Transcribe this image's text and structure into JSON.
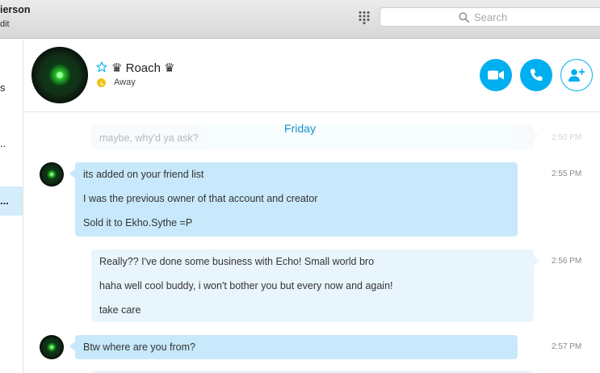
{
  "account": {
    "name": "ierson",
    "edit_label": "dit"
  },
  "search": {
    "placeholder": "Search"
  },
  "sidebar": {
    "fragments": [
      "s",
      "..",
      "..."
    ]
  },
  "contact": {
    "prefix_crown": "♛",
    "name": "Roach",
    "suffix_crown": "♛",
    "status": "Away"
  },
  "colors": {
    "accent": "#00aff0",
    "incoming_bubble": "#c8e9fb",
    "outgoing_bubble": "#e9f5fc",
    "away": "#f3c316",
    "day_label": "#1793d1"
  },
  "icons": [
    "dialpad-icon",
    "search-icon",
    "star-icon",
    "clock-icon",
    "video-call-icon",
    "phone-icon",
    "add-contact-icon"
  ],
  "conversation": {
    "day_label": "Friday",
    "previous": {
      "text": "maybe, why'd ya ask?",
      "time": "2:50 PM"
    },
    "messages": [
      {
        "direction": "in",
        "time": "2:55 PM",
        "lines": [
          "its added on your friend list",
          "I was the previous owner of that account and creator",
          "Sold it to Ekho.Sythe =P"
        ]
      },
      {
        "direction": "out",
        "time": "2:56 PM",
        "lines": [
          "Really?? I've done some business with Echo!  Small world bro",
          "haha well cool buddy, i won't bother you but every now and again!",
          "take care"
        ]
      },
      {
        "direction": "in",
        "time": "2:57 PM",
        "lines": [
          "Btw where are you from?"
        ]
      }
    ]
  }
}
